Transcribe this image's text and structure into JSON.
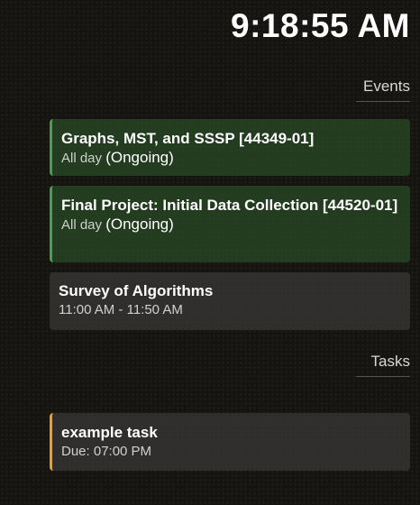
{
  "clock": {
    "time": "9:18:55 AM"
  },
  "events": {
    "heading": "Events",
    "items": [
      {
        "title": "Graphs, MST, and SSSP [44349-01]",
        "when": "All day",
        "status": "(Ongoing)"
      },
      {
        "title": "Final Project: Initial Data Collection [44520-01]",
        "when": "All day",
        "status": "(Ongoing)"
      },
      {
        "title": "Survey of Algorithms",
        "when": "11:00 AM - 11:50 AM"
      }
    ]
  },
  "tasks": {
    "heading": "Tasks",
    "items": [
      {
        "title": "example task",
        "due": "Due: 07:00 PM"
      }
    ]
  },
  "colors": {
    "event_accent": "#4aa04a",
    "task_accent": "#f0a020",
    "event_background": "#284824",
    "neutral_card_background": "#373532"
  }
}
